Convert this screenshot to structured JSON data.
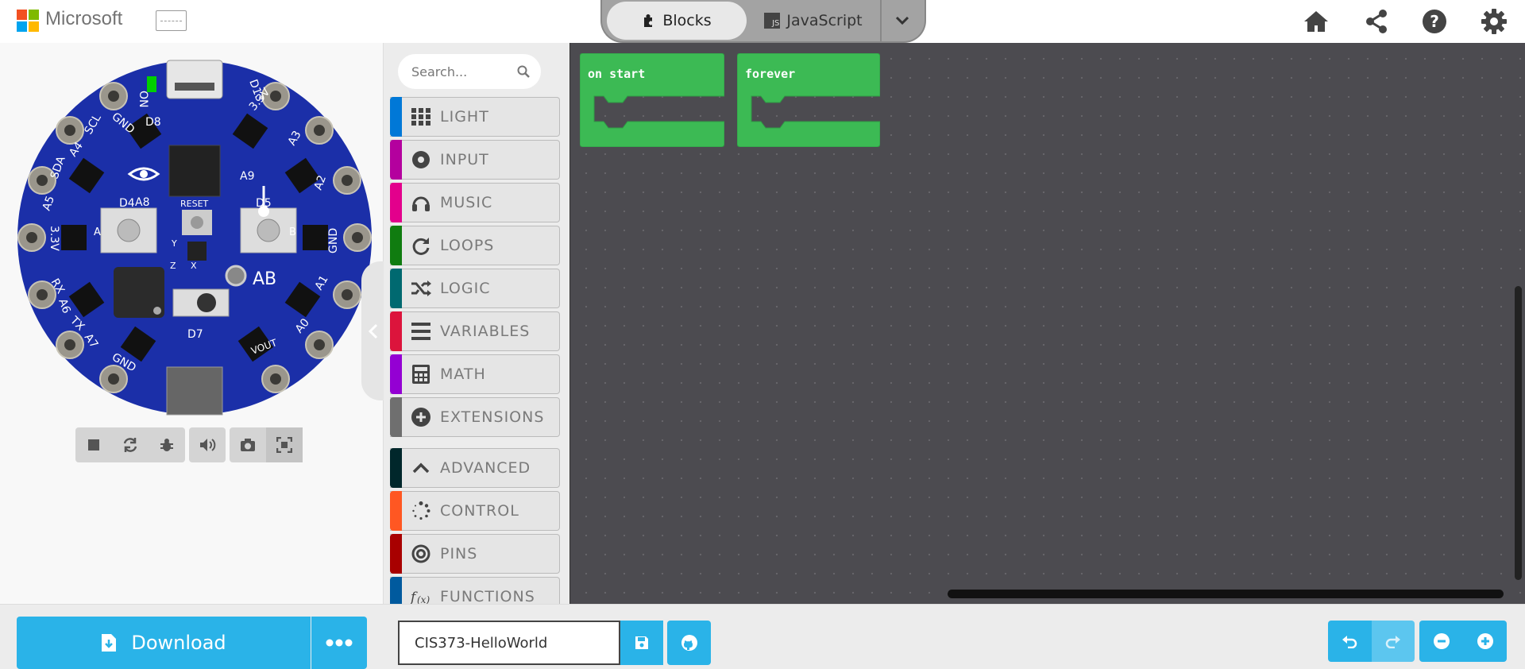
{
  "header": {
    "brand": "Microsoft",
    "logo_colors": [
      "#f25022",
      "#7fba00",
      "#00a4ef",
      "#ffb900"
    ],
    "editor_tabs": [
      {
        "label": "Blocks",
        "icon": "puzzle-icon",
        "selected": true
      },
      {
        "label": "JavaScript",
        "icon": "js-icon",
        "selected": false
      }
    ],
    "js_badge": "JS",
    "actions": [
      "home-icon",
      "share-icon",
      "help-icon",
      "settings-icon"
    ]
  },
  "simulator": {
    "board_color": "#1b2fa8",
    "labels": {
      "on": "ON",
      "d13": "D13",
      "gnd_top": "GND",
      "d8": "D8",
      "v33_top": "3.3V",
      "a3": "A3",
      "scl": "SCL",
      "a4": "A4",
      "a9": "A9",
      "a2": "A2",
      "sda": "SDA",
      "a5": "A5",
      "a8": "A8",
      "reset": "RESET",
      "d4": "D4",
      "d5": "D5",
      "v33_left": "3.3V",
      "btn_a": "A",
      "btn_b": "B",
      "gnd_right": "GND",
      "ab": "AB",
      "rx": "RX",
      "a6": "A6",
      "a1": "A1",
      "tx": "TX",
      "a7": "A7",
      "a0": "A0",
      "d7": "D7",
      "gnd_bottom": "GND",
      "vout": "VOUT",
      "axis_y": "Y",
      "axis_z": "Z",
      "axis_x": "X"
    },
    "controls": [
      "stop-icon",
      "restart-icon",
      "debug-icon",
      "sound-icon",
      "screenshot-icon",
      "fullscreen-icon"
    ]
  },
  "toolbox": {
    "search_placeholder": "Search...",
    "categories": [
      {
        "label": "LIGHT",
        "color": "#0078d7",
        "icon": "grid-icon"
      },
      {
        "label": "INPUT",
        "color": "#b4009e",
        "icon": "input-dot-icon"
      },
      {
        "label": "MUSIC",
        "color": "#e3008c",
        "icon": "headphones-icon"
      },
      {
        "label": "LOOPS",
        "color": "#107c10",
        "icon": "loop-arrow-icon"
      },
      {
        "label": "LOGIC",
        "color": "#006970",
        "icon": "shuffle-icon"
      },
      {
        "label": "VARIABLES",
        "color": "#dc143c",
        "icon": "list-lines-icon"
      },
      {
        "label": "MATH",
        "color": "#9400d3",
        "icon": "calculator-icon"
      },
      {
        "label": "EXTENSIONS",
        "color": "#6f6f6f",
        "icon": "plus-circle-icon"
      },
      {
        "label": "ADVANCED",
        "color": "#00272b",
        "icon": "chevron-up-icon"
      },
      {
        "label": "CONTROL",
        "color": "#ff5722",
        "icon": "spinner-icon"
      },
      {
        "label": "PINS",
        "color": "#a80000",
        "icon": "target-icon"
      },
      {
        "label": "FUNCTIONS",
        "color": "#005a9e",
        "icon": "function-icon"
      }
    ]
  },
  "workspace": {
    "blocks": [
      {
        "label": "on start",
        "color": "#3cba54"
      },
      {
        "label": "forever",
        "color": "#3cba54"
      }
    ]
  },
  "footer": {
    "download_label": "Download",
    "project_name": "CIS373-HelloWorld",
    "buttons": [
      "more-icon",
      "save-icon",
      "github-icon",
      "undo-icon",
      "redo-icon",
      "zoom-out-icon",
      "zoom-in-icon"
    ]
  }
}
